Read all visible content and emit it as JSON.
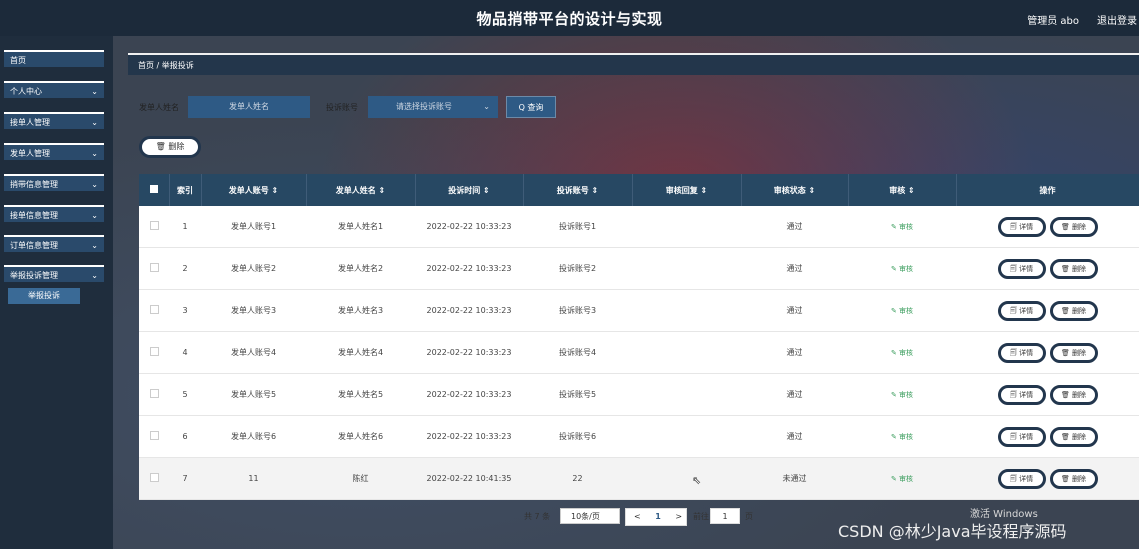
{
  "header": {
    "title": "物品捎带平台的设计与实现",
    "admin": "管理员 abo",
    "logout": "退出登录"
  },
  "sidebar": {
    "items": [
      {
        "label": "首页",
        "chevron": false
      },
      {
        "label": "个人中心",
        "chevron": true
      },
      {
        "label": "接单人管理",
        "chevron": true
      },
      {
        "label": "发单人管理",
        "chevron": true
      },
      {
        "label": "捎带信息管理",
        "chevron": true
      },
      {
        "label": "接单信息管理",
        "chevron": true
      },
      {
        "label": "订单信息管理",
        "chevron": true
      },
      {
        "label": "举报投诉管理",
        "chevron": true
      }
    ],
    "sub_item": "举报投诉",
    "chevron_glyph": "⌄"
  },
  "breadcrumb": "首页 / 举报投诉",
  "filters": {
    "name_label": "发单人姓名",
    "name_placeholder": "发单人姓名",
    "account_label": "投诉账号",
    "account_placeholder": "请选择投诉账号",
    "query_button": "Q 查询"
  },
  "delete_button": "🗑 删除",
  "table": {
    "headers": [
      "■",
      "索引",
      "发单人账号 ⇕",
      "发单人姓名 ⇕",
      "投诉时间 ⇕",
      "投诉账号 ⇕",
      "审核回复 ⇕",
      "审核状态 ⇕",
      "审核 ⇕",
      "操作"
    ],
    "audit_label": "✎ 审核",
    "detail_label": "🗐 详情",
    "delete_label": "🗑 删除",
    "rows": [
      {
        "index": "1",
        "account": "发单人账号1",
        "name": "发单人姓名1",
        "time": "2022-02-22 10:33:23",
        "complaint": "投诉账号1",
        "reply": "",
        "status": "通过"
      },
      {
        "index": "2",
        "account": "发单人账号2",
        "name": "发单人姓名2",
        "time": "2022-02-22 10:33:23",
        "complaint": "投诉账号2",
        "reply": "",
        "status": "通过"
      },
      {
        "index": "3",
        "account": "发单人账号3",
        "name": "发单人姓名3",
        "time": "2022-02-22 10:33:23",
        "complaint": "投诉账号3",
        "reply": "",
        "status": "通过"
      },
      {
        "index": "4",
        "account": "发单人账号4",
        "name": "发单人姓名4",
        "time": "2022-02-22 10:33:23",
        "complaint": "投诉账号4",
        "reply": "",
        "status": "通过"
      },
      {
        "index": "5",
        "account": "发单人账号5",
        "name": "发单人姓名5",
        "time": "2022-02-22 10:33:23",
        "complaint": "投诉账号5",
        "reply": "",
        "status": "通过"
      },
      {
        "index": "6",
        "account": "发单人账号6",
        "name": "发单人姓名6",
        "time": "2022-02-22 10:33:23",
        "complaint": "投诉账号6",
        "reply": "",
        "status": "通过"
      },
      {
        "index": "7",
        "account": "11",
        "name": "陈红",
        "time": "2022-02-22 10:41:35",
        "complaint": "22",
        "reply": "",
        "status": "未通过"
      }
    ]
  },
  "pagination": {
    "total": "共 7 条",
    "page_size": "10条/页",
    "prev": "<",
    "current": "1",
    "next": ">",
    "goto_label": "前往",
    "goto_value": "1",
    "page_suffix": "页"
  },
  "watermark": {
    "windows": "激活 Windows",
    "csdn": "CSDN @林少Java毕设程序源码"
  }
}
